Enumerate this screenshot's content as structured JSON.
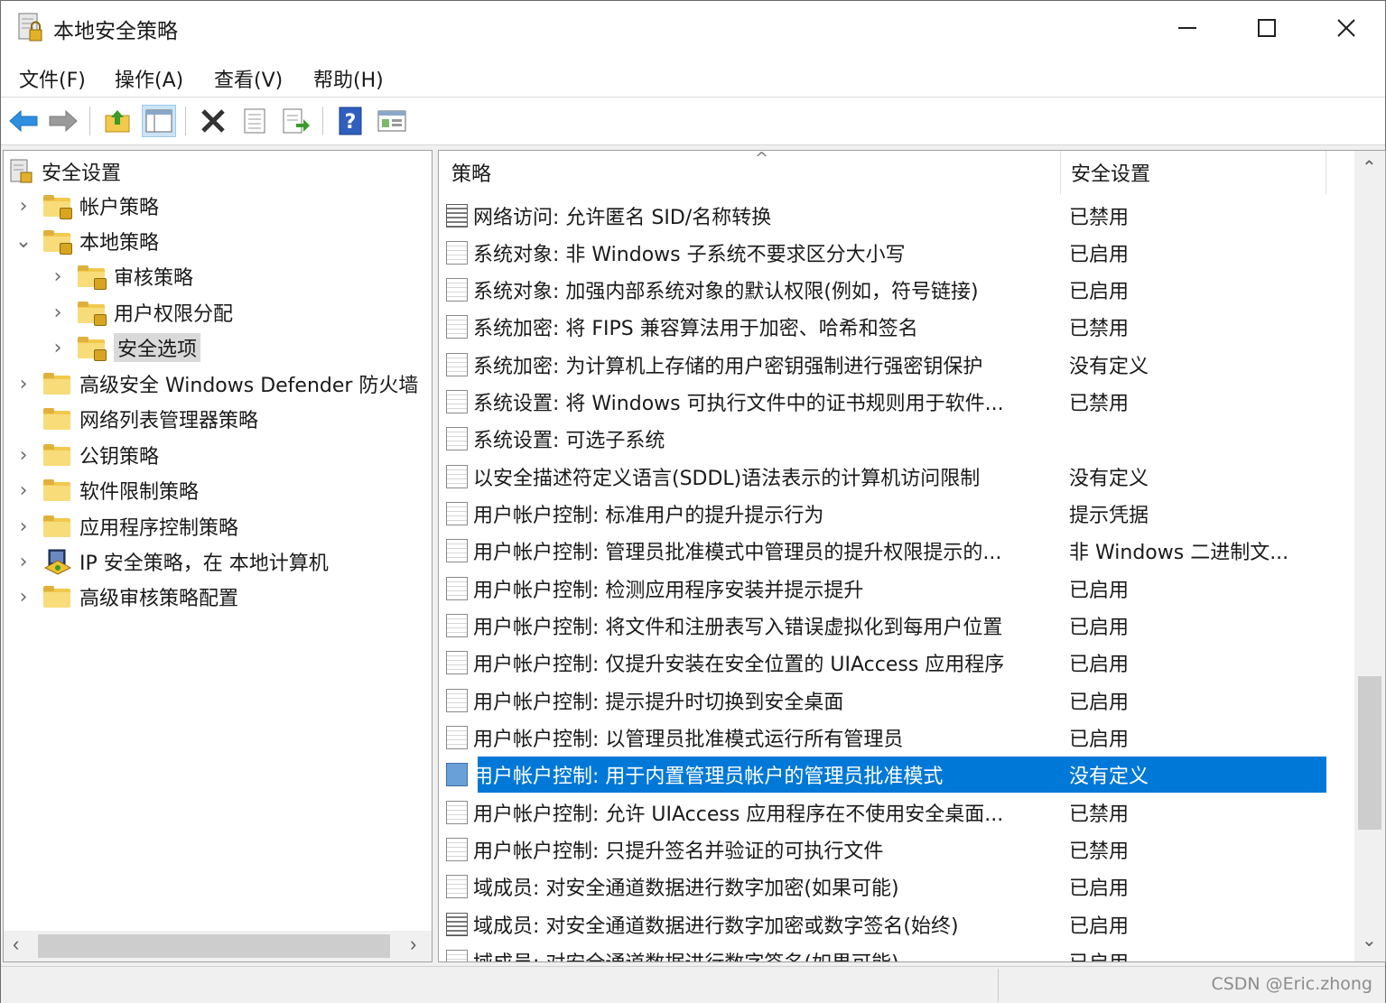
{
  "window": {
    "title": "本地安全策略",
    "minimize": "—",
    "maximize": "☐",
    "close": "✕"
  },
  "menu": {
    "file": "文件(F)",
    "action": "操作(A)",
    "view": "查看(V)",
    "help": "帮助(H)"
  },
  "toolbar": {
    "icons": [
      "back-icon",
      "forward-icon",
      "up-folder-icon",
      "show-hide-tree-icon",
      "delete-icon",
      "properties-icon",
      "export-list-icon",
      "help-icon",
      "mmc-view-icon"
    ]
  },
  "tree": {
    "root": "安全设置",
    "items": [
      {
        "label": "帐户策略"
      },
      {
        "label": "本地策略"
      },
      {
        "label": "审核策略"
      },
      {
        "label": "用户权限分配"
      },
      {
        "label": "安全选项"
      },
      {
        "label": "高级安全 Windows Defender 防火墙"
      },
      {
        "label": "网络列表管理器策略"
      },
      {
        "label": "公钥策略"
      },
      {
        "label": "软件限制策略"
      },
      {
        "label": "应用程序控制策略"
      },
      {
        "label": "IP 安全策略，在 本地计算机"
      },
      {
        "label": "高级审核策略配置"
      }
    ],
    "selected": "安全选项"
  },
  "table": {
    "columns": {
      "policy": "策略",
      "setting": "安全设置"
    },
    "sort_indicator": "^",
    "rows": [
      {
        "policy": "网络访问: 允许匿名 SID/名称转换",
        "setting": "已禁用"
      },
      {
        "policy": "系统对象: 非 Windows 子系统不要求区分大小写",
        "setting": "已启用"
      },
      {
        "policy": "系统对象: 加强内部系统对象的默认权限(例如，符号链接)",
        "setting": "已启用"
      },
      {
        "policy": "系统加密: 将 FIPS 兼容算法用于加密、哈希和签名",
        "setting": "已禁用"
      },
      {
        "policy": "系统加密: 为计算机上存储的用户密钥强制进行强密钥保护",
        "setting": "没有定义"
      },
      {
        "policy": "系统设置: 将 Windows 可执行文件中的证书规则用于软件...",
        "setting": "已禁用"
      },
      {
        "policy": "系统设置: 可选子系统",
        "setting": ""
      },
      {
        "policy": "以安全描述符定义语言(SDDL)语法表示的计算机访问限制",
        "setting": "没有定义"
      },
      {
        "policy": "用户帐户控制: 标准用户的提升提示行为",
        "setting": "提示凭据"
      },
      {
        "policy": "用户帐户控制: 管理员批准模式中管理员的提升权限提示的...",
        "setting": "非 Windows 二进制文..."
      },
      {
        "policy": "用户帐户控制: 检测应用程序安装并提示提升",
        "setting": "已启用"
      },
      {
        "policy": "用户帐户控制: 将文件和注册表写入错误虚拟化到每用户位置",
        "setting": "已启用"
      },
      {
        "policy": "用户帐户控制: 仅提升安装在安全位置的 UIAccess 应用程序",
        "setting": "已启用"
      },
      {
        "policy": "用户帐户控制: 提示提升时切换到安全桌面",
        "setting": "已启用"
      },
      {
        "policy": "用户帐户控制: 以管理员批准模式运行所有管理员",
        "setting": "已启用"
      },
      {
        "policy": "用户帐户控制: 用于内置管理员帐户的管理员批准模式",
        "setting": "没有定义"
      },
      {
        "policy": "用户帐户控制: 允许 UIAccess 应用程序在不使用安全桌面...",
        "setting": "已禁用"
      },
      {
        "policy": "用户帐户控制: 只提升签名并验证的可执行文件",
        "setting": "已禁用"
      },
      {
        "policy": "域成员: 对安全通道数据进行数字加密(如果可能)",
        "setting": "已启用"
      },
      {
        "policy": "域成员: 对安全通道数据进行数字加密或数字签名(始终)",
        "setting": "已启用"
      },
      {
        "policy": "域成员: 对安全通道数据进行数字签名(如果可能)",
        "setting": "已启用"
      }
    ],
    "selected_row": "用户帐户控制: 用于内置管理员帐户的管理员批准模式"
  },
  "watermark": "CSDN @Eric.zhong",
  "colors": {
    "selection": "#0078d7",
    "folder": "#f2c94c"
  }
}
